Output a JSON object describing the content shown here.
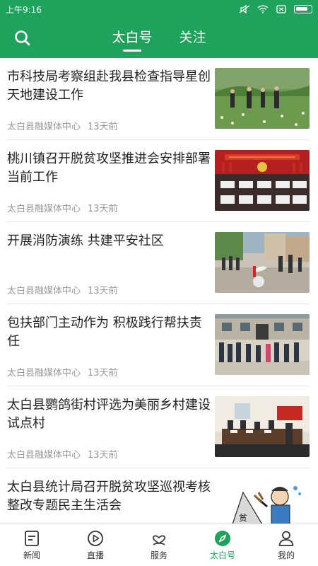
{
  "status": {
    "time": "上午9:16"
  },
  "header": {
    "tabs": [
      {
        "label": "太白号",
        "active": true
      },
      {
        "label": "关注",
        "active": false
      }
    ]
  },
  "feed": {
    "items": [
      {
        "title": "市科技局考察组赴我县检查指导星创天地建设工作",
        "source": "太白县融媒体中心",
        "time": "13天前"
      },
      {
        "title": "桃川镇召开脱贫攻坚推进会安排部署当前工作",
        "source": "太白县融媒体中心",
        "time": "13天前"
      },
      {
        "title": "开展消防演练 共建平安社区",
        "source": "太白县融媒体中心",
        "time": "13天前"
      },
      {
        "title": "包扶部门主动作为 积极践行帮扶责任",
        "source": "太白县融媒体中心",
        "time": "13天前"
      },
      {
        "title": "太白县鹦鸽街村评选为美丽乡村建设试点村",
        "source": "太白县融媒体中心",
        "time": "13天前"
      },
      {
        "title": "太白县统计局召开脱贫攻坚巡视考核整改专题民主生活会",
        "source": "",
        "time": ""
      }
    ]
  },
  "tabbar": {
    "items": [
      {
        "label": "新闻",
        "icon": "news-icon"
      },
      {
        "label": "直播",
        "icon": "play-icon"
      },
      {
        "label": "服务",
        "icon": "service-icon"
      },
      {
        "label": "太白号",
        "icon": "compass-icon"
      },
      {
        "label": "我的",
        "icon": "user-icon"
      }
    ],
    "active_index": 3
  },
  "colors": {
    "brand": "#1fa25c"
  }
}
